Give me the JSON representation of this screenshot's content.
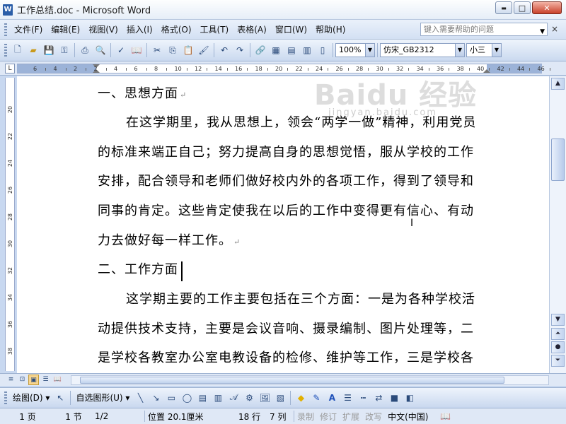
{
  "window": {
    "title": "工作总结.doc - Microsoft Word",
    "icon_letter": "W"
  },
  "window_buttons": {
    "minimize": "▬",
    "maximize": "□",
    "close": "✕"
  },
  "menubar": {
    "items": [
      "文件(F)",
      "编辑(E)",
      "视图(V)",
      "插入(I)",
      "格式(O)",
      "工具(T)",
      "表格(A)",
      "窗口(W)",
      "帮助(H)"
    ],
    "help_placeholder": "键入需要帮助的问题",
    "close_doc": "×"
  },
  "toolbar": {
    "zoom": "100%",
    "font": "仿宋_GB2312",
    "size": "小三"
  },
  "ruler": {
    "corner": "L",
    "h_numbers": [
      "6",
      "4",
      "2",
      "2",
      "4",
      "6",
      "8",
      "10",
      "12",
      "14",
      "16",
      "18",
      "20",
      "22",
      "24",
      "26",
      "28",
      "30",
      "32",
      "34",
      "36",
      "38",
      "40",
      "42",
      "44",
      "46"
    ],
    "v_numbers": [
      "20",
      "22",
      "24",
      "26",
      "28",
      "30",
      "32",
      "34",
      "36",
      "38",
      "40"
    ]
  },
  "document": {
    "lines": [
      "一、思想方面",
      "在这学期里，我从思想上，领会“两学一做”精神，利用党员",
      "的标准来端正自己；努力提高自身的思想觉悟，服从学校的工作",
      "安排，配合领导和老师们做好校内外的各项工作，得到了领导和",
      "同事的肯定。这些肯定使我在以后的工作中变得更有信心、有动",
      "力去做好每一样工作。",
      "二、工作方面",
      "这学期主要的工作主要包括在三个方面：一是为各种学校活",
      "动提供技术支持，主要是会议音响、摄录编制、图片处理等，二",
      "是学校各教室办公室电教设备的检修、维护等工作，三是学校各"
    ],
    "para_mark": "↵"
  },
  "watermark": {
    "text": "Baidu 经验",
    "sub": "jingyan.baidu.com"
  },
  "drawing_toolbar": {
    "draw_label": "绘图(D)",
    "autoshape_label": "自选图形(U)"
  },
  "statusbar": {
    "page": "1 页",
    "section": "1 节",
    "page_of": "1/2",
    "position": "位置 20.1厘米",
    "line": "18 行",
    "column": "7 列",
    "rec": "录制",
    "trk": "修订",
    "ext": "扩展",
    "ovr": "改写",
    "lang": "中文(中国)"
  }
}
